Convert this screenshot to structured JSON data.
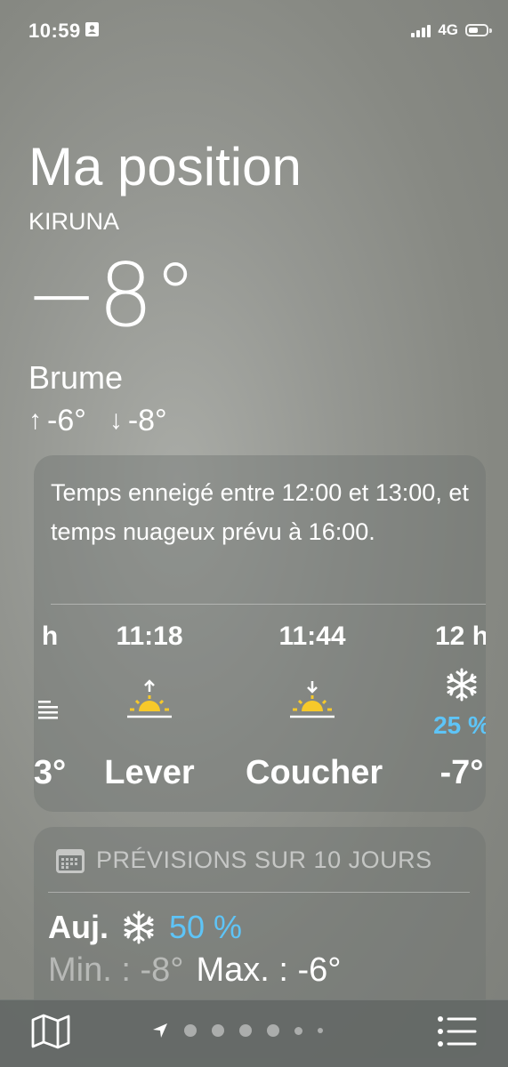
{
  "status_bar": {
    "time": "10:59",
    "network": "4G",
    "id_icon": "contact-card-icon",
    "battery_icon": "battery-icon"
  },
  "location": {
    "title": "Ma position",
    "city": "KIRUNA"
  },
  "current": {
    "temperature": "−8°",
    "condition": "Brume",
    "high": "-6°",
    "low": "-8°",
    "high_arrow": "↑",
    "low_arrow": "↓"
  },
  "hourly": {
    "summary": "Temps enneigé entre 12:00 et 13:00, et temps nuageux prévu à 16:00.",
    "items": [
      {
        "time": "h",
        "icon": "fog-icon",
        "precip": "",
        "value": "3°"
      },
      {
        "time": "11:18",
        "icon": "sunrise-icon",
        "precip": "",
        "value": "Lever"
      },
      {
        "time": "11:44",
        "icon": "sunset-icon",
        "precip": "",
        "value": "Coucher"
      },
      {
        "time": "12 h",
        "icon": "snowflake-icon",
        "precip": "25 %",
        "value": "-7°"
      }
    ]
  },
  "forecast": {
    "header": "PRÉVISIONS SUR 10 JOURS",
    "header_icon": "calendar-icon",
    "today": {
      "day": "Auj.",
      "icon": "snowflake-icon",
      "precip": "50 %",
      "min": "Min. : -8°",
      "max": "Max. : -6°"
    }
  },
  "bottom_bar": {
    "map_icon": "map-icon",
    "location_icon": "location-arrow-icon",
    "list_icon": "list-icon",
    "page_count": 6
  },
  "colors": {
    "precip_blue": "#5ec4f7",
    "sun_yellow": "#f7c92a"
  }
}
